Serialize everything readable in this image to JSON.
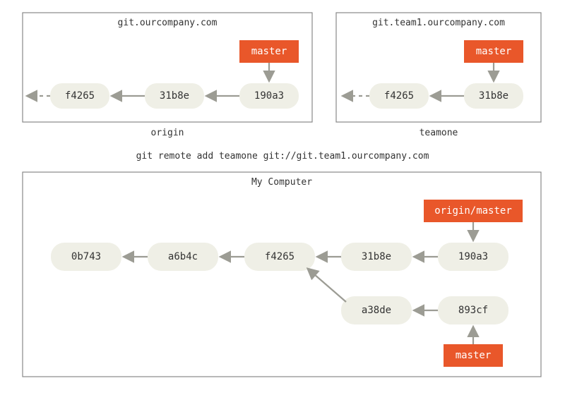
{
  "origin": {
    "title": "git.ourcompany.com",
    "caption": "origin",
    "ref": "master",
    "commits": [
      "f4265",
      "31b8e",
      "190a3"
    ]
  },
  "teamone": {
    "title": "git.team1.ourcompany.com",
    "caption": "teamone",
    "ref": "master",
    "commits": [
      "f4265",
      "31b8e"
    ]
  },
  "command": "git remote add teamone git://git.team1.ourcompany.com",
  "local": {
    "title": "My Computer",
    "refs": {
      "remote": "origin/master",
      "local": "master"
    },
    "row1": [
      "0b743",
      "a6b4c",
      "f4265",
      "31b8e",
      "190a3"
    ],
    "row2": [
      "a38de",
      "893cf"
    ]
  }
}
